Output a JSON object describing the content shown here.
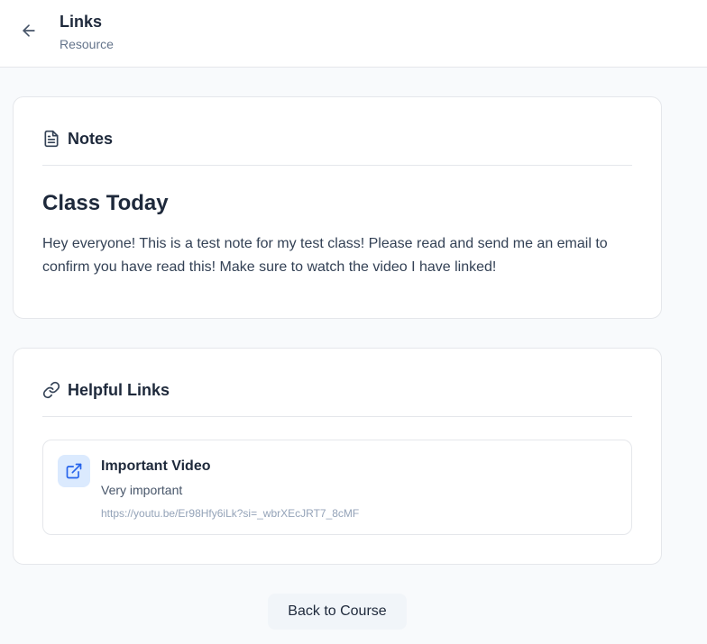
{
  "header": {
    "title": "Links",
    "subtitle": "Resource"
  },
  "notes": {
    "heading": "Notes",
    "title": "Class Today",
    "body": "Hey everyone! This is a test note for my test class! Please read and send me an email to confirm you have read this! Make sure to watch the video I have linked!"
  },
  "links": {
    "heading": "Helpful Links",
    "items": [
      {
        "title": "Important Video",
        "description": "Very important",
        "url": "https://youtu.be/Er98Hfy6iLk?si=_wbrXEcJRT7_8cMF"
      }
    ]
  },
  "footer": {
    "back_label": "Back to Course"
  },
  "colors": {
    "accent": "#2563eb",
    "icon_bg": "#dbeafe",
    "muted_text": "#64748b"
  },
  "icons": {
    "back": "arrow-left-icon",
    "notes": "document-icon",
    "links": "link-icon",
    "link_item": "external-link-icon"
  }
}
